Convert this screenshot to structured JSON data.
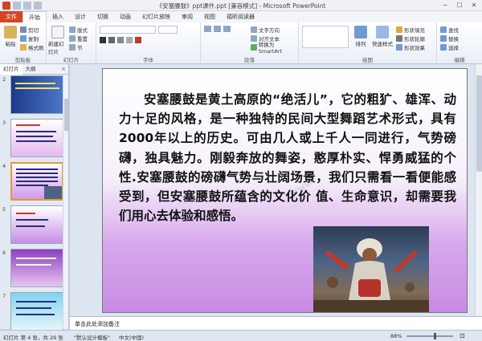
{
  "window": {
    "title": "《安塞腰鼓》ppt课件.ppt [兼容模式] - Microsoft PowerPoint",
    "minimize_glyph": "─",
    "maximize_glyph": "☐",
    "close_glyph": "✕"
  },
  "ribbon_tabs": [
    "文件",
    "开始",
    "插入",
    "设计",
    "切换",
    "动画",
    "幻灯片放映",
    "审阅",
    "视图",
    "福昕阅读器"
  ],
  "ribbon": {
    "paste": "粘贴",
    "cut": "剪切",
    "copy": "复制",
    "format_painter": "格式刷",
    "clipboard": "剪贴板",
    "new_slide": "新建幻灯片",
    "layout": "版式",
    "reset": "重置",
    "section": "节",
    "slides": "幻灯片",
    "font": "字体",
    "text_direction": "文字方向",
    "align_text": "对齐文本",
    "convert_smartart": "转换为 SmartArt",
    "paragraph": "段落",
    "drawing": "绘图",
    "arrange": "排列",
    "quick_styles": "快速样式",
    "shape_fill": "形状填充",
    "shape_outline": "形状轮廓",
    "shape_effects": "形状效果",
    "find": "查找",
    "replace": "替换",
    "select": "选择",
    "editing": "编辑"
  },
  "left_panel": {
    "tab_slides": "幻灯片",
    "tab_outline": "大纲",
    "close": "×",
    "thumbnails": [
      {
        "num": "2",
        "selected": false
      },
      {
        "num": "3",
        "selected": false
      },
      {
        "num": "4",
        "selected": true
      },
      {
        "num": "5",
        "selected": false
      },
      {
        "num": "6",
        "selected": false
      },
      {
        "num": "7",
        "selected": false
      }
    ]
  },
  "slide": {
    "text": "安塞腰鼓是黄土高原的“绝活儿”，它的粗犷、雄浑、动力十足的风格，是一种独特的民间大型舞蹈艺术形式，具有2000年以上的历史。可由几人或上千人一同进行，气势磅礴，独具魅力。刚毅奔放的舞姿，憨厚朴实、悍勇威猛的个性.安塞腰鼓的磅礴气势与壮阔场景，我们只需看一看便能感受到，但安塞腰鼓所蕴含的文化价 值、生命意识，却需要我们用心去体验和感悟。",
    "photo_desc": "drummer-photo"
  },
  "notes": {
    "placeholder": "单击此处添加备注"
  },
  "status": {
    "slide_info": "幻灯片 第 4 张，共 29 张",
    "theme": "\"默认设计模板\"",
    "language": "中文(中国)",
    "zoom": "88%"
  },
  "colors": {
    "file_tab": "#d24726",
    "slide_gradient_end": "#c78be3"
  }
}
